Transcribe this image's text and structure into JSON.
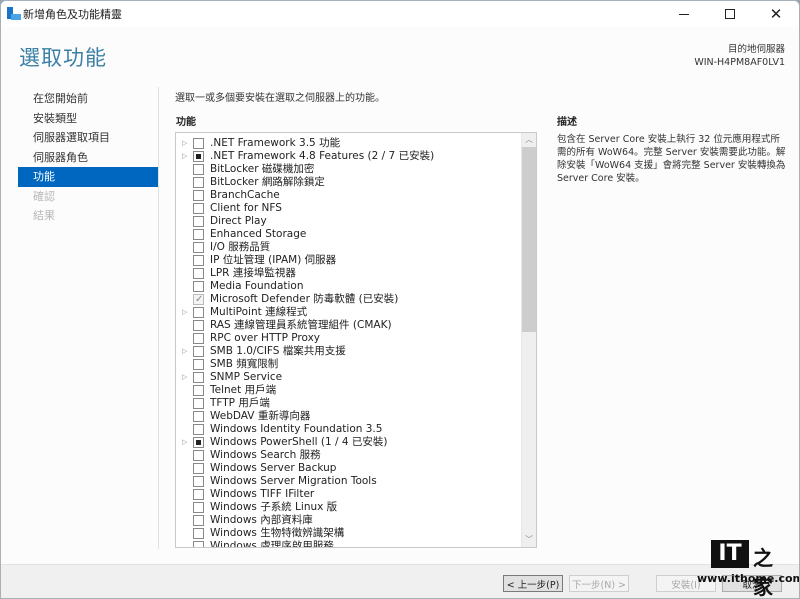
{
  "window": {
    "title": "新增角色及功能精靈",
    "controls": {
      "minimize": "minimize",
      "maximize": "maximize",
      "close": "✕"
    }
  },
  "header": {
    "page_title": "選取功能",
    "destination_label": "目的地伺服器",
    "destination_server": "WIN-H4PM8AF0LV1"
  },
  "sidebar": {
    "items": [
      {
        "label": "在您開始前",
        "state": "normal"
      },
      {
        "label": "安裝類型",
        "state": "normal"
      },
      {
        "label": "伺服器選取項目",
        "state": "normal"
      },
      {
        "label": "伺服器角色",
        "state": "normal"
      },
      {
        "label": "功能",
        "state": "active"
      },
      {
        "label": "確認",
        "state": "disabled"
      },
      {
        "label": "結果",
        "state": "disabled"
      }
    ]
  },
  "main": {
    "instruction": "選取一或多個要安裝在選取之伺服器上的功能。",
    "features_heading": "功能",
    "features": [
      {
        "label": ".NET Framework 3.5 功能",
        "expandable": true,
        "state": "unchecked"
      },
      {
        "label": ".NET Framework 4.8 Features (2 / 7 已安裝)",
        "expandable": true,
        "state": "partial"
      },
      {
        "label": "BitLocker 磁碟機加密",
        "expandable": false,
        "state": "unchecked"
      },
      {
        "label": "BitLocker 網路解除鎖定",
        "expandable": false,
        "state": "unchecked"
      },
      {
        "label": "BranchCache",
        "expandable": false,
        "state": "unchecked"
      },
      {
        "label": "Client for NFS",
        "expandable": false,
        "state": "unchecked"
      },
      {
        "label": "Direct Play",
        "expandable": false,
        "state": "unchecked"
      },
      {
        "label": "Enhanced Storage",
        "expandable": false,
        "state": "unchecked"
      },
      {
        "label": "I/O 服務品質",
        "expandable": false,
        "state": "unchecked"
      },
      {
        "label": "IP 位址管理 (IPAM) 伺服器",
        "expandable": false,
        "state": "unchecked"
      },
      {
        "label": "LPR 連接埠監視器",
        "expandable": false,
        "state": "unchecked"
      },
      {
        "label": "Media Foundation",
        "expandable": false,
        "state": "unchecked"
      },
      {
        "label": "Microsoft Defender 防毒軟體 (已安裝)",
        "expandable": false,
        "state": "checked-disabled"
      },
      {
        "label": "MultiPoint 連線程式",
        "expandable": true,
        "state": "unchecked"
      },
      {
        "label": "RAS 連線管理員系統管理組件 (CMAK)",
        "expandable": false,
        "state": "unchecked"
      },
      {
        "label": "RPC over HTTP Proxy",
        "expandable": false,
        "state": "unchecked"
      },
      {
        "label": "SMB 1.0/CIFS 檔案共用支援",
        "expandable": true,
        "state": "unchecked"
      },
      {
        "label": "SMB 頻寬限制",
        "expandable": false,
        "state": "unchecked"
      },
      {
        "label": "SNMP Service",
        "expandable": true,
        "state": "unchecked"
      },
      {
        "label": "Telnet 用戶端",
        "expandable": false,
        "state": "unchecked"
      },
      {
        "label": "TFTP 用戶端",
        "expandable": false,
        "state": "unchecked"
      },
      {
        "label": "WebDAV 重新導向器",
        "expandable": false,
        "state": "unchecked"
      },
      {
        "label": "Windows Identity Foundation 3.5",
        "expandable": false,
        "state": "unchecked"
      },
      {
        "label": "Windows PowerShell (1 / 4 已安裝)",
        "expandable": true,
        "state": "partial"
      },
      {
        "label": "Windows Search 服務",
        "expandable": false,
        "state": "unchecked"
      },
      {
        "label": "Windows Server Backup",
        "expandable": false,
        "state": "unchecked"
      },
      {
        "label": "Windows Server Migration Tools",
        "expandable": false,
        "state": "unchecked"
      },
      {
        "label": "Windows TIFF IFilter",
        "expandable": false,
        "state": "unchecked"
      },
      {
        "label": "Windows 子系統 Linux 版",
        "expandable": false,
        "state": "unchecked"
      },
      {
        "label": "Windows 內部資料庫",
        "expandable": false,
        "state": "unchecked"
      },
      {
        "label": "Windows 生物特徵辨識架構",
        "expandable": false,
        "state": "unchecked"
      },
      {
        "label": "Windows 處理序啟用服務",
        "expandable": false,
        "state": "unchecked"
      }
    ],
    "scroll_position_fraction": 0.0
  },
  "description": {
    "heading": "描述",
    "text": "包含在 Server Core 安裝上執行 32 位元應用程式所需的所有 WoW64。完整 Server 安裝需要此功能。解除安裝「WoW64 支援」會將完整 Server 安裝轉換為 Server Core 安裝。"
  },
  "footer": {
    "prev_label": "< 上一步(P)",
    "next_label": "下一步(N) >",
    "install_label": "安裝(I)",
    "cancel_label": "取消"
  },
  "watermark": {
    "logo_text": "IT",
    "logo_zh": "之家",
    "url": "www.ithome.com"
  }
}
